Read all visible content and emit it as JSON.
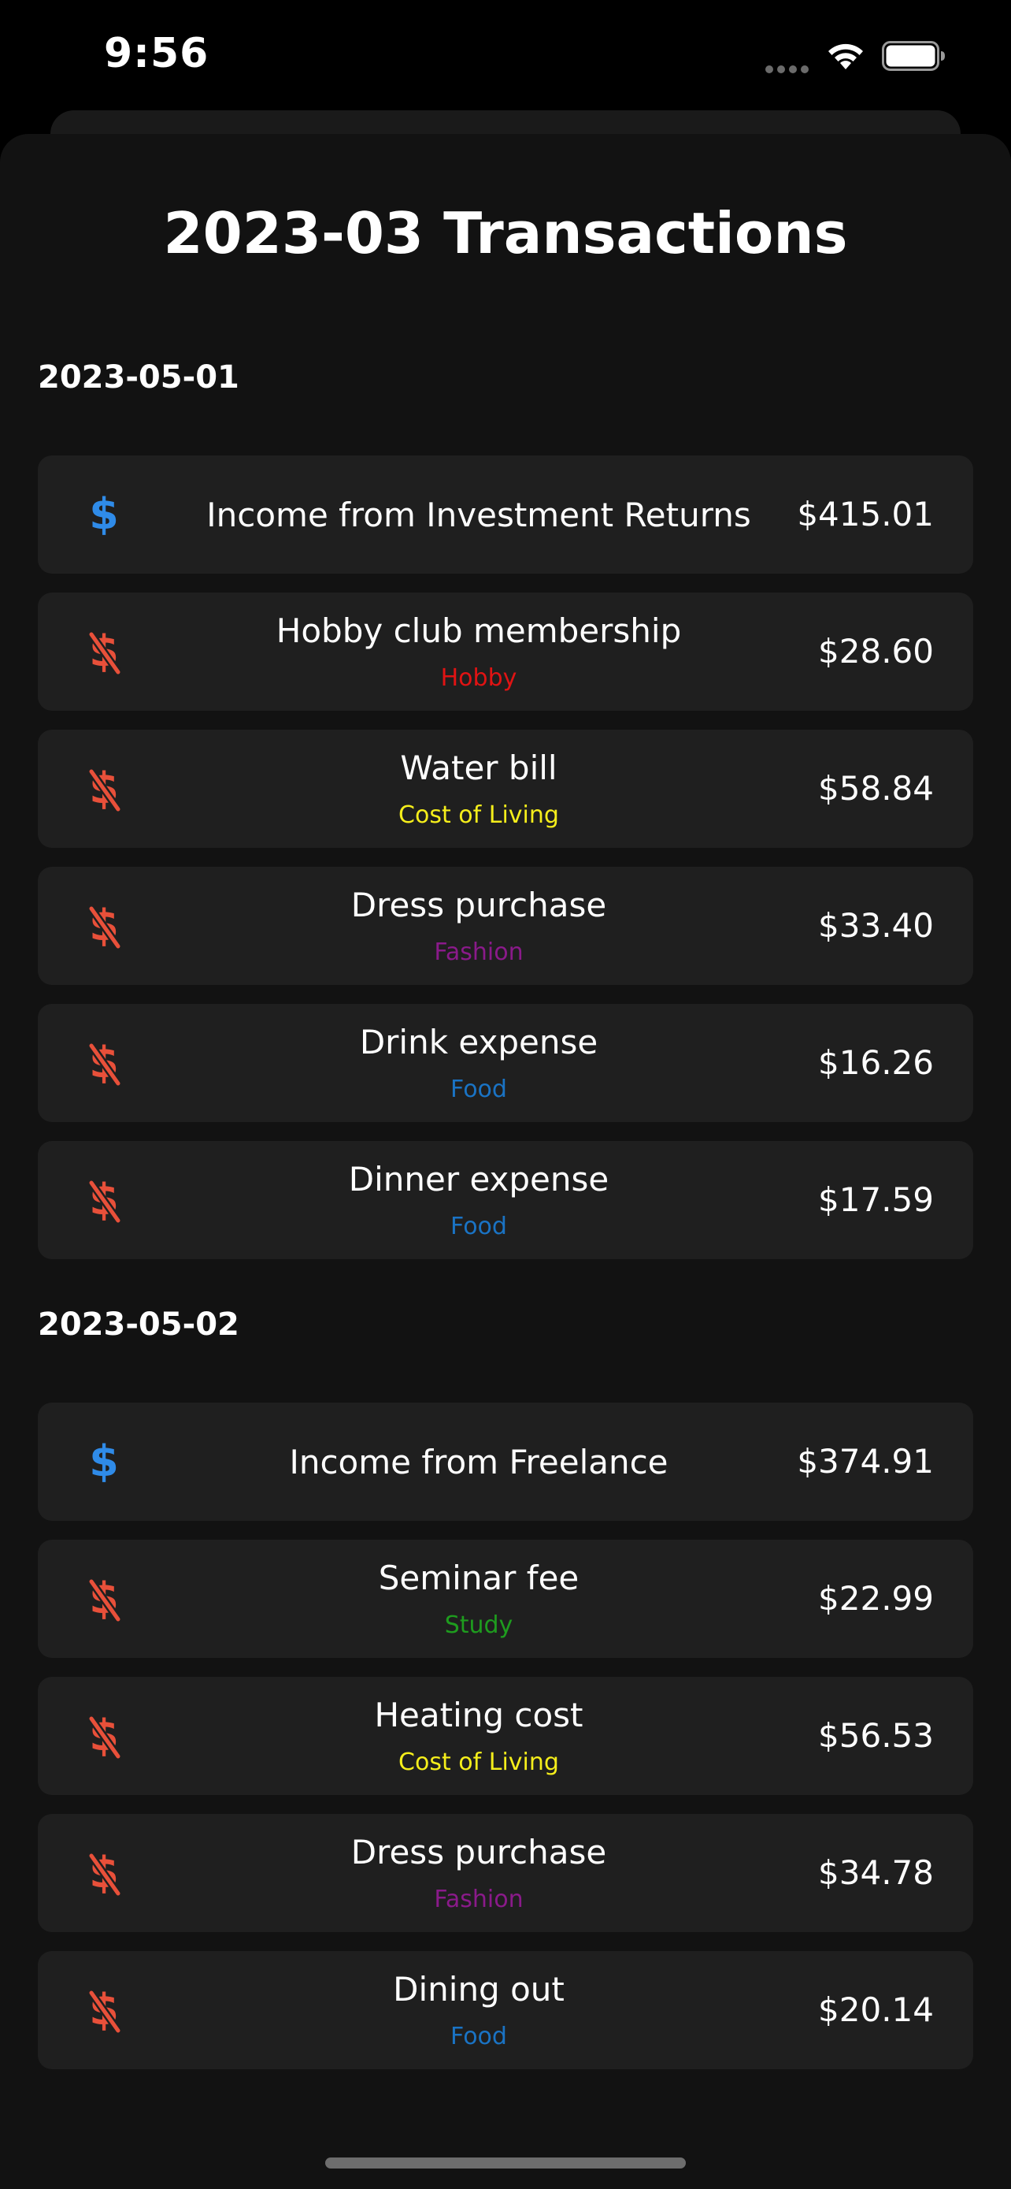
{
  "status_bar": {
    "time": "9:56"
  },
  "page": {
    "title": "2023-03 Transactions"
  },
  "colors": {
    "income_icon": "#2f8be8",
    "expense_icon": "#e8503a",
    "Hobby": "#e01313",
    "Cost of Living": "#f5ee1b",
    "Fashion": "#8a1a8a",
    "Food": "#1a73c4",
    "Study": "#1e9c1e"
  },
  "days": [
    {
      "date": "2023-05-01",
      "transactions": [
        {
          "type": "income",
          "icon": "dollar-icon",
          "title": "Income from Investment Returns",
          "category": "",
          "amount": "$415.01"
        },
        {
          "type": "expense",
          "icon": "dollar-slash-icon",
          "title": "Hobby club membership",
          "category": "Hobby",
          "amount": "$28.60"
        },
        {
          "type": "expense",
          "icon": "dollar-slash-icon",
          "title": "Water bill",
          "category": "Cost of Living",
          "amount": "$58.84"
        },
        {
          "type": "expense",
          "icon": "dollar-slash-icon",
          "title": "Dress purchase",
          "category": "Fashion",
          "amount": "$33.40"
        },
        {
          "type": "expense",
          "icon": "dollar-slash-icon",
          "title": "Drink expense",
          "category": "Food",
          "amount": "$16.26"
        },
        {
          "type": "expense",
          "icon": "dollar-slash-icon",
          "title": "Dinner expense",
          "category": "Food",
          "amount": "$17.59"
        }
      ]
    },
    {
      "date": "2023-05-02",
      "transactions": [
        {
          "type": "income",
          "icon": "dollar-icon",
          "title": "Income from Freelance",
          "category": "",
          "amount": "$374.91"
        },
        {
          "type": "expense",
          "icon": "dollar-slash-icon",
          "title": "Seminar fee",
          "category": "Study",
          "amount": "$22.99"
        },
        {
          "type": "expense",
          "icon": "dollar-slash-icon",
          "title": "Heating cost",
          "category": "Cost of Living",
          "amount": "$56.53"
        },
        {
          "type": "expense",
          "icon": "dollar-slash-icon",
          "title": "Dress purchase",
          "category": "Fashion",
          "amount": "$34.78"
        },
        {
          "type": "expense",
          "icon": "dollar-slash-icon",
          "title": "Dining out",
          "category": "Food",
          "amount": "$20.14"
        }
      ]
    }
  ]
}
